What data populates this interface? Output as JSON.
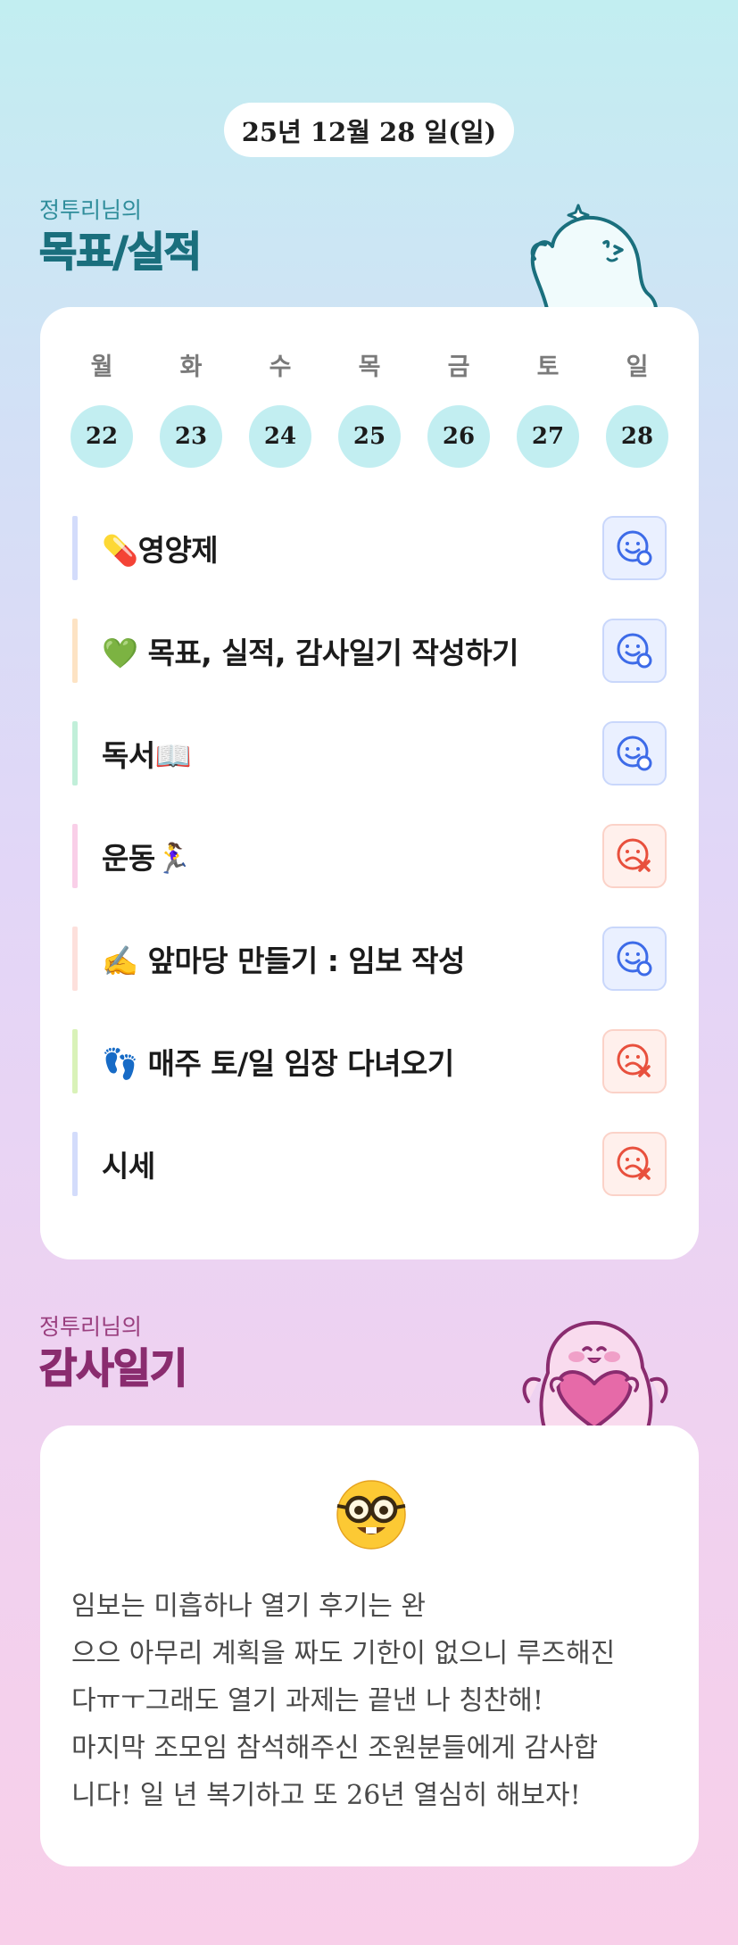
{
  "date_label": "25년 12월 28 일(일)",
  "goals_section": {
    "subtitle": "정투리님의",
    "title": "목표/실적"
  },
  "week": [
    {
      "day": "월",
      "date": "22"
    },
    {
      "day": "화",
      "date": "23"
    },
    {
      "day": "수",
      "date": "24"
    },
    {
      "day": "목",
      "date": "25"
    },
    {
      "day": "금",
      "date": "26"
    },
    {
      "day": "토",
      "date": "27"
    },
    {
      "day": "일",
      "date": "28"
    }
  ],
  "goals": [
    {
      "label": "💊영양제",
      "status": "done",
      "bar_color": "#d3dcfb"
    },
    {
      "label": "💚 목표, 실적, 감사일기 작성하기",
      "status": "done",
      "bar_color": "#fde3c4"
    },
    {
      "label": "독서📖",
      "status": "done",
      "bar_color": "#c1efd9"
    },
    {
      "label": "운동🏃‍♀️",
      "status": "fail",
      "bar_color": "#f9cfe8"
    },
    {
      "label": "✍️ 앞마당 만들기 : 임보 작성",
      "status": "done",
      "bar_color": "#fde0dc"
    },
    {
      "label": "👣 매주 토/일 임장 다녀오기",
      "status": "fail",
      "bar_color": "#d9f2b8"
    },
    {
      "label": "시세",
      "status": "fail",
      "bar_color": "#d3dcfb"
    }
  ],
  "diary_section": {
    "subtitle": "정투리님의",
    "title": "감사일기",
    "emoji": "nerd-face-emoji",
    "lines": [
      "임보는 미흡하나 열기 후기는 완",
      "으으 아무리 계획을 짜도 기한이 없으니 루즈해진",
      "다ㅠㅜ그래도 열기 과제는 끝낸 나 칭찬해!",
      "마지막 조모임 참석해주신 조원분들에게 감사합",
      "니다! 일 년 복기하고 또 26년 열심히 해보자!"
    ]
  },
  "colors": {
    "accent_teal": "#1a6f7d",
    "accent_plum": "#8a2c6f",
    "day_circle": "#c2eef1",
    "done_icon": "#3d6be8",
    "fail_icon": "#e8503d"
  }
}
